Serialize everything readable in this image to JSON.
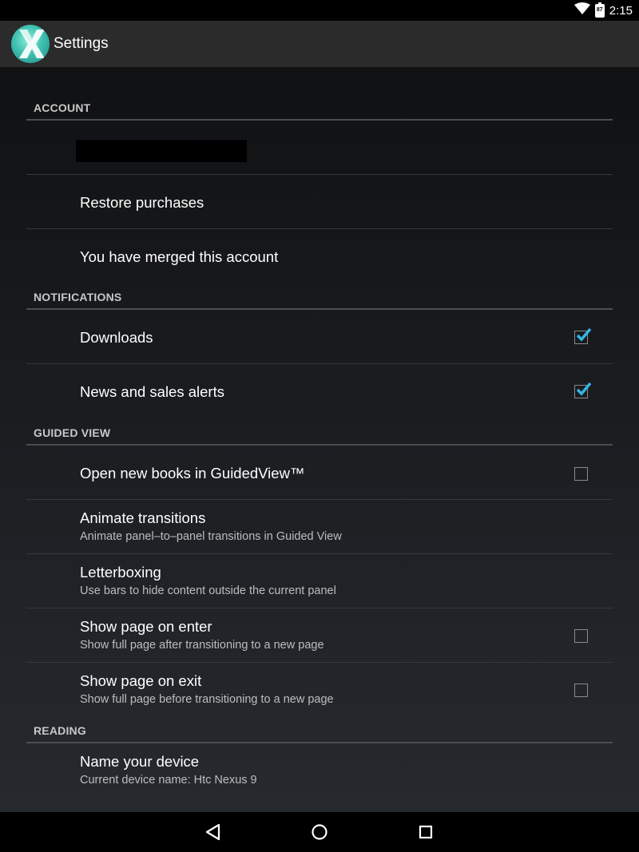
{
  "status_bar": {
    "time": "2:15",
    "battery_level": "87",
    "icons": [
      "wifi-icon",
      "battery-icon"
    ]
  },
  "action_bar": {
    "title": "Settings",
    "logo": "app-logo-icon"
  },
  "sections": {
    "account": {
      "header": "ACCOUNT",
      "items": [
        {
          "title": ""
        },
        {
          "title": "Restore purchases"
        },
        {
          "title": "You have merged this account"
        }
      ]
    },
    "notifications": {
      "header": "NOTIFICATIONS",
      "items": [
        {
          "title": "Downloads",
          "checked": true
        },
        {
          "title": "News and sales alerts",
          "checked": true
        }
      ]
    },
    "guided_view": {
      "header": "GUIDED VIEW",
      "items": [
        {
          "title": "Open new books in GuidedView™",
          "checked": false
        },
        {
          "title": "Animate transitions",
          "summary": "Animate panel–to–panel transitions in Guided View"
        },
        {
          "title": "Letterboxing",
          "summary": "Use bars to hide content outside the current panel"
        },
        {
          "title": "Show page on enter",
          "summary": "Show full page after transitioning to a new page",
          "checked": false
        },
        {
          "title": "Show page on exit",
          "summary": "Show full page before transitioning to a new page",
          "checked": false
        }
      ]
    },
    "reading": {
      "header": "READING",
      "items": [
        {
          "title": "Name your device",
          "summary": "Current device name: Htc Nexus 9"
        }
      ]
    }
  },
  "colors": {
    "accent": "#33b5e5",
    "action_bar": "#2b2b2b",
    "divider": "#4a4d51"
  },
  "nav_bar": {
    "icons": [
      "back-icon",
      "home-icon",
      "recents-icon"
    ]
  }
}
